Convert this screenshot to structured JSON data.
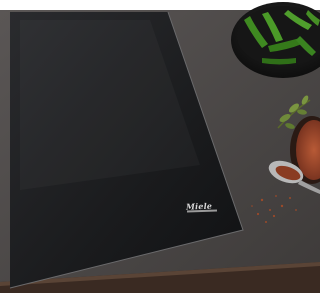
{
  "photo": {
    "brand_text": "Miele",
    "colors": {
      "backdrop": "#ffffff",
      "countertop": "#4a4645",
      "cooktop_glass": "#1a1b1d",
      "wood_edge": "#3a2a22",
      "bowl": "#121212",
      "pepper": "#3f8a21",
      "spice": "#a84a2a",
      "spoon": "#b8b8b8",
      "herb": "#6f8a3a"
    },
    "objects": [
      "induction-cooktop",
      "countertop",
      "pepper-bowl",
      "green-chili-peppers",
      "herb-sprig",
      "spice-bowl",
      "metal-spoon",
      "scattered-spices",
      "wooden-counter-edge"
    ]
  }
}
